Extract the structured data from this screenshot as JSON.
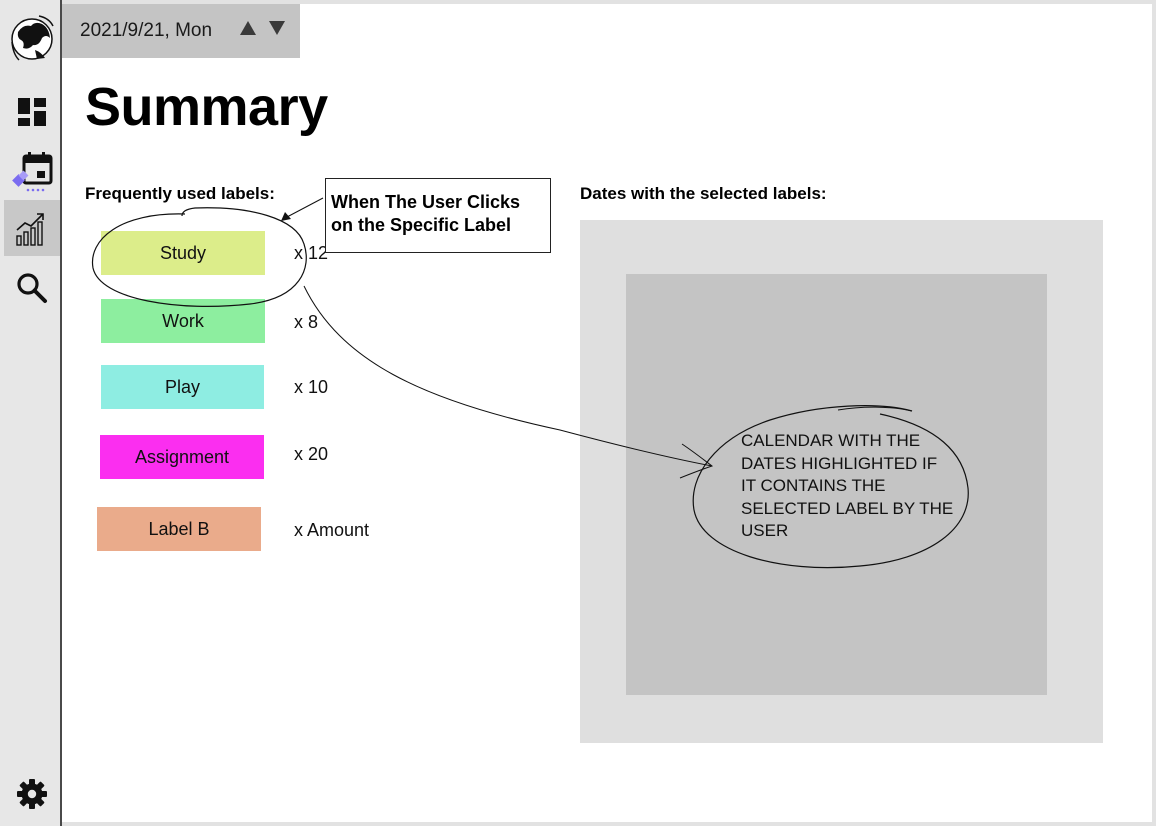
{
  "header": {
    "date": "2021/9/21, Mon",
    "date_up_icon": "triangle-up-icon",
    "date_down_icon": "triangle-down-icon"
  },
  "sidebar": {
    "items": [
      {
        "name": "logo",
        "icon": "globe-logo-icon"
      },
      {
        "name": "dashboard",
        "icon": "dashboard-icon"
      },
      {
        "name": "calendar",
        "icon": "calendar-event-icon"
      },
      {
        "name": "summary",
        "icon": "chart-growth-icon",
        "active": true
      },
      {
        "name": "search",
        "icon": "search-icon"
      },
      {
        "name": "settings",
        "icon": "gear-icon"
      }
    ]
  },
  "page": {
    "title": "Summary",
    "labels_heading": "Frequently used labels:",
    "dates_heading": "Dates with the selected labels:"
  },
  "labels": [
    {
      "name": "Study",
      "count": "x 12",
      "color": "#dced8a"
    },
    {
      "name": "Work",
      "count": "x 8",
      "color": "#8dee9f"
    },
    {
      "name": "Play",
      "count": "x 10",
      "color": "#8eede2"
    },
    {
      "name": "Assignment",
      "count": "x 20",
      "color": "#fb2ef0"
    },
    {
      "name": "Label B",
      "count": "x Amount",
      "color": "#eaab8b"
    }
  ],
  "annotation": {
    "callout_text": "When The User Clicks on the Specific Label",
    "calendar_note": "CALENDAR WITH THE DATES HIGHLIGHTED IF IT CONTAINS THE SELECTED LABEL BY THE USER"
  },
  "colors": {
    "sidebar_bg": "#e7e7e7",
    "sidebar_active": "#c8c8c8",
    "date_bar_bg": "#c4c4c4",
    "calendar_outer": "#dfdfdf",
    "calendar_inner": "#c4c4c4",
    "accent_purple": "#7b6cf0"
  }
}
